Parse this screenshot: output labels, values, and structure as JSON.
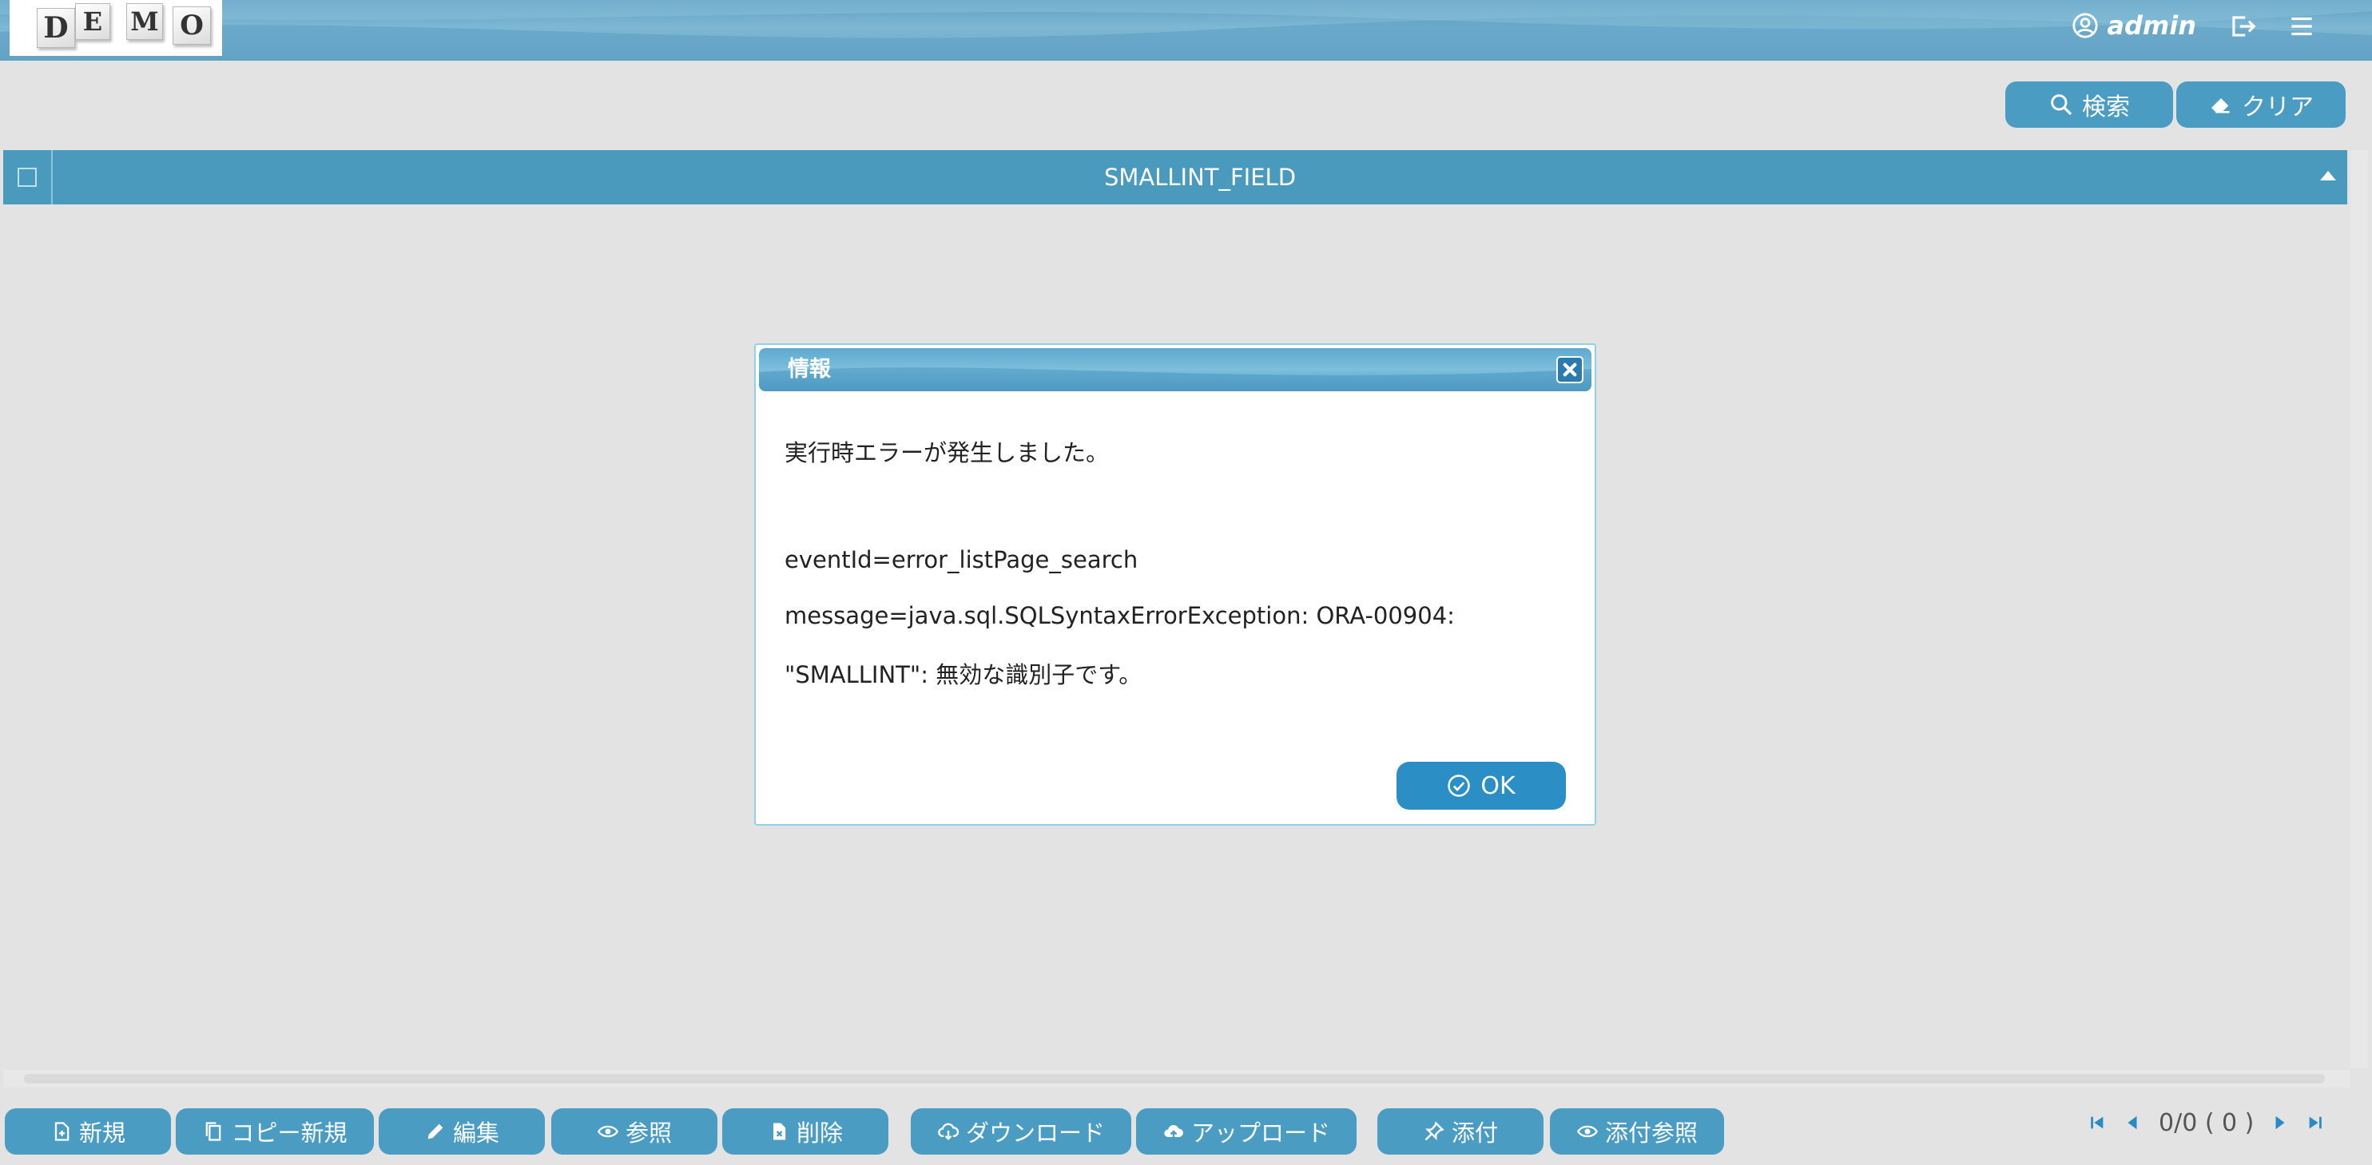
{
  "app": {
    "logo_letters": [
      "D",
      "E",
      "M",
      "O"
    ],
    "user_name": "admin"
  },
  "toolbar": {
    "search_label": "検索",
    "clear_label": "クリア"
  },
  "grid": {
    "columns": [
      "SMALLINT_FIELD"
    ],
    "sort": "ascending"
  },
  "dialog": {
    "title": "情報",
    "lines": [
      "実行時エラーが発生しました。",
      "eventId=error_listPage_search",
      "message=java.sql.SQLSyntaxErrorException: ORA-00904:",
      "\"SMALLINT\": 無効な識別子です。"
    ],
    "ok_label": "OK"
  },
  "bottom_buttons": {
    "new": "新規",
    "copy_new": "コピー新規",
    "edit": "編集",
    "view": "参照",
    "delete": "削除",
    "download": "ダウンロード",
    "upload": "アップロード",
    "attach": "添付",
    "attach_view": "添付参照"
  },
  "pager": {
    "text": "0/0 ( 0 )"
  },
  "colors": {
    "accent": "#4a9cc2",
    "header": "#6aa9cb",
    "background": "#e3e3e3"
  }
}
